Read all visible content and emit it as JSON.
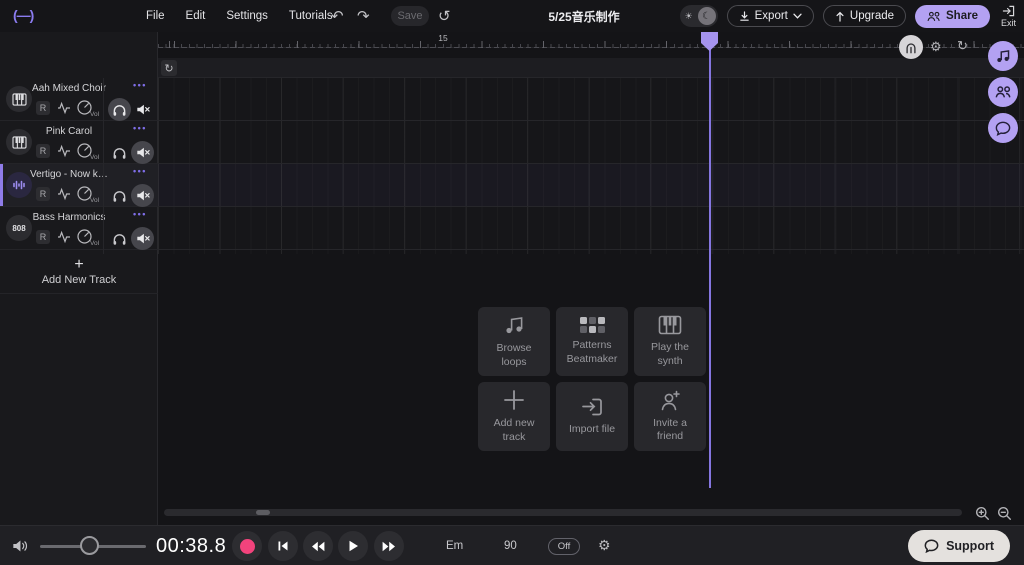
{
  "topbar": {
    "menus": [
      "File",
      "Edit",
      "Settings",
      "Tutorials"
    ],
    "save_label": "Save",
    "project_title": "5/25音乐制作",
    "export_label": "Export",
    "upgrade_label": "Upgrade",
    "share_label": "Share",
    "exit_label": "Exit"
  },
  "sidebar": {
    "tracks": [
      {
        "name": "Aah Mixed Choir",
        "record_label": "R",
        "vol_label": "Vol"
      },
      {
        "name": "Pink Carol",
        "record_label": "R",
        "vol_label": "Vol"
      },
      {
        "name": "Vertigo - Now ki...",
        "record_label": "R",
        "vol_label": "Vol"
      },
      {
        "name": "Bass Harmonics",
        "icon_label": "808",
        "record_label": "R",
        "vol_label": "Vol"
      }
    ],
    "add_new_track_label": "Add New Track"
  },
  "timeline": {
    "bar_label": "15"
  },
  "empty_state": {
    "buttons": [
      {
        "label": "Browse loops"
      },
      {
        "label": "Patterns Beatmaker"
      },
      {
        "label": "Play the synth"
      },
      {
        "label": "Add new track"
      },
      {
        "label": "Import file"
      },
      {
        "label": "Invite a friend"
      }
    ]
  },
  "transport": {
    "time_display": "00:38.8",
    "key": "Em",
    "tempo": "90",
    "count_in": "Off"
  },
  "support_label": "Support",
  "colors": {
    "accent": "#b3a1f2",
    "playhead": "#8f7ce8",
    "record": "#f2437c"
  }
}
